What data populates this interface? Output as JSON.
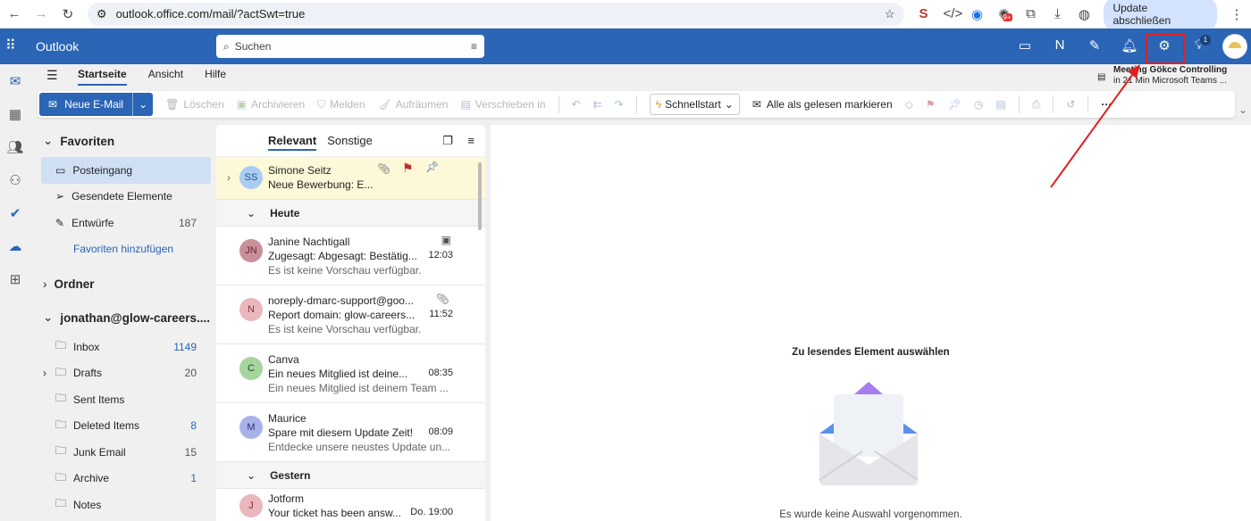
{
  "browser": {
    "url": "outlook.office.com/mail/?actSwt=true",
    "update_label": "Update abschließen",
    "ext_badge": "9+"
  },
  "app": {
    "name": "Outlook",
    "search_placeholder": "Suchen",
    "notif_badge": "1"
  },
  "meeting": {
    "title": "Meeting Gökce Controlling",
    "subtitle": "in 21 Min Microsoft Teams ..."
  },
  "ribbon": {
    "tabs": [
      "Startseite",
      "Ansicht",
      "Hilfe"
    ],
    "new_mail": "Neue E-Mail",
    "delete": "Löschen",
    "archive": "Archivieren",
    "report": "Melden",
    "sweep": "Aufräumen",
    "move": "Verschieben in",
    "quickstep": "Schnellstart",
    "mark_read": "Alle als gelesen markieren",
    "more": "···"
  },
  "favorites": {
    "title": "Favoriten",
    "items": [
      {
        "label": "Posteingang"
      },
      {
        "label": "Gesendete Elemente"
      },
      {
        "label": "Entwürfe",
        "count": "187"
      }
    ],
    "add": "Favoriten hinzufügen"
  },
  "folders_title": "Ordner",
  "account": {
    "title": "jonathan@glow-careers....",
    "items": [
      {
        "label": "Inbox",
        "count": "1149"
      },
      {
        "label": "Drafts",
        "count": "20"
      },
      {
        "label": "Sent Items"
      },
      {
        "label": "Deleted Items",
        "count": "8"
      },
      {
        "label": "Junk Email",
        "count": "15"
      },
      {
        "label": "Archive",
        "count": "1"
      },
      {
        "label": "Notes"
      }
    ]
  },
  "list": {
    "tabs": [
      "Relevant",
      "Sonstige"
    ],
    "pinned": {
      "initials": "SS",
      "from": "Simone Seitz",
      "subject": "Neue Bewerbung: E..."
    },
    "groups": [
      {
        "label": "Heute"
      },
      {
        "label": "Gestern"
      }
    ],
    "today": [
      {
        "initials": "JN",
        "from": "Janine Nachtigall",
        "subject": "Zugesagt: Abgesagt: Bestätig...",
        "time": "12:03",
        "preview": "Es ist keine Vorschau verfügbar.",
        "color": "#c98f9a",
        "fg": "#6b2a36"
      },
      {
        "initials": "N",
        "from": "noreply-dmarc-support@goo...",
        "subject": "Report domain: glow-careers...",
        "time": "11:52",
        "preview": "Es ist keine Vorschau verfügbar.",
        "color": "#eab7bc",
        "fg": "#8a2c36"
      },
      {
        "initials": "C",
        "from": "Canva",
        "subject": "Ein neues Mitglied ist deine...",
        "time": "08:35",
        "preview": "Ein neues Mitglied ist deinem Team ...",
        "color": "#a6d49d",
        "fg": "#22502a"
      },
      {
        "initials": "M",
        "from": "Maurice",
        "subject": "Spare mit diesem Update Zeit!",
        "time": "08:09",
        "preview": "Entdecke unsere neustes Update un...",
        "color": "#a9b2e8",
        "fg": "#2a3580"
      }
    ],
    "yesterday": [
      {
        "initials": "J",
        "from": "Jotform",
        "subject": "Your ticket has been answ...",
        "time": "Do. 19:00",
        "color": "#eab7bc",
        "fg": "#8a2c36"
      }
    ]
  },
  "reading": {
    "title": "Zu lesendes Element auswählen",
    "empty": "Es wurde keine Auswahl vorgenommen."
  }
}
